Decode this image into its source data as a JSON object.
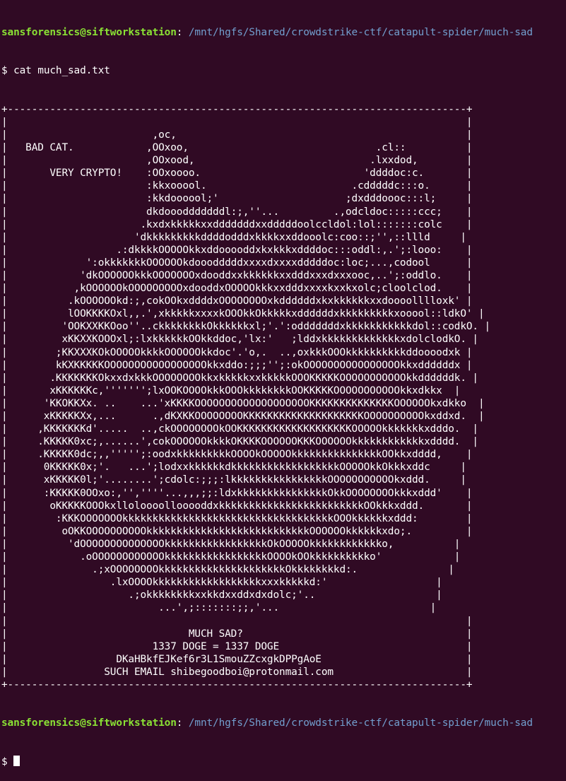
{
  "prompt": {
    "user": "sansforensics@siftworkstation",
    "colon": ":",
    "path": " /mnt/hgfs/Shared/crowdstrike-ctf/catapult-spider/much-sad",
    "dollar": "$ "
  },
  "command": "cat much_sad.txt",
  "file_lines": [
    "+----------------------------------------------------------------------------+",
    "|                                                                            |",
    "|                        ,oc,                                                |",
    "|   BAD CAT.            ,OOxoo,                               .cl::          |",
    "|                       ,OOxood,                             .lxxdod,        |",
    "|       VERY CRYPTO!    :OOxoooo.                           'ddddoc:c.       |",
    "|                       :kkxooool.                        .cdddddc:::o.      |",
    "|                       :kkdoooool;'                     ;dxdddoooc:::l;     |",
    "|                       dkdooodddddddl:;,''...         .,odcldoc:::::ccc;    |",
    "|                      .kxdxkkkkkxxdddddddxxdddddoolccldol:lol:::::::colc    |",
    "|                     'dkkkkkkkkkddddodddxkkkkxxddooolc:coo::;'',::llld     |",
    "|                  .:dkkkkOOOOOkkxddooooddxkxkkkxddddoc:::oddl:,.';:looo:    |",
    "|             ':okkkkkkkOOOOOOkdooodddddxxxxdxxxxdddddoc:loc;...,codool      |",
    "|            'dkOOOOOOkkkOOOOOOOxdooddxxkkkkkkxxdddxxxdxxxooc,..';:oddlo.    |",
    "|           ,kOOOOOOkOOOOOOOOOxdooddxOOOOOkkkxxdddxxxxkxxkxolc;cloolclod.    |",
    "|          .kOOOOOOkd:;,cokOOkxddddxOOOOOOOOxkddddddxkxkkkkkkxxdoooolllloxk' |",
    "|          lOOKKKKOxl,,.',xkkkkkxxxxkOOOkkOkkkkkxddddddxkkkkkkkkkxooool::ldkO' |",
    "|         'OOKXXKKOoo''..ckkkkkkkkOkkkkkkxl;'.':odddddddxkkkkkkkkkkkdol::codkO. |",
    "|         xKKXXKOOOxl;:lxkkkkkkOOkkddoc,'lx:'   ;lddxkkkkkkkkkkkkkxdolclodkO. |",
    "|        ;KKXXXKOkOOOOOkkkkOOOOOOkkdoc'.'o,.  ..,oxkkkOOOkkkkkkkkkkddoooodxk |",
    "|        kKXKKKKKOOOOOOOOOOOOOOOOOkkxddo:;;;'';:okOOOOOOOOOOOOOOOOkkxddddddx |",
    "|       .KKKKKKKOkxxdxkkkOOOOOOOOkkxkkkkkxxkkkkkOOOKKKKKOOOOOOOOOOOkkddddddk. |",
    "|       xKKKKKKc,''''''';lxOOKOOOOkkkOOOkkkkkkkkOOKKKKKOOOOOOOOOOOkkxdkkx  |",
    "|      'KKOKKXx. ..    ...'xKKKKOOOOOOOOOOOOOOOOOOOKKKKKKKKKKKKKKOOOOOOkxdkko  |",
    "|      xKKKKKXx,...      .,dKXKKOOOOOOOOKKKKKKKKKKKKKKKKKKKKOOOOOOOOOOkxddxd.  |",
    "|     ,KKKKKKKd'.....  ..,ckOOOOOOOOkOOKKKKKKKKKKKKKKKKKKKOOOOOkkkkkkkxdddo.  |",
    "|     .KKKKK0xc;,......',cokOOOOOOkkkkOKKKKOOOOOOKKKOOOOOOkkkkkkkkkkkkxdddd.  |",
    "|     .KKKKK0dc;,,''''';:oodxkkkkkkkkkOOOOkOOOOOkkkkkkkkkkkkkkkOOkkxdddd,    |",
    "|      0KKKKK0x;'.   ...';lodxxkkkkkkdkkkkkkkkkkkkkkkkkkOOOOOkkOkkkxddc     |",
    "|      xKKKKK0l;'........';cdolc:;;;:lkkkkkkkkkkkkkkkkOOOOOOOOOOOkxddd.     |",
    "|      :KKKKK0OOxo:,'',''''...,,,;;:ldxkkkkkkkkkkkkkkkOkkOOOOOOOOkkkxddd'    |",
    "|       oKKKKKOOOkxlloloooollooooddxkkkkkkkkkkkkkkkkkkkkkkkkOOkkkxddd.       |",
    "|        :KKKOOOOOOOkkkkkkkkkkkkkkkkkkkkkkkkkkkkkkkkkkkOOOkkkkkkxddd:        |",
    "|         oOKKOOOOOOOOOOkkkkkkkkkkkkkkkkkkkkkkkkkkkOOOOOOkkkkkkxdo;.         |",
    "|          'dOOOOOOOOOOOOOOkkkkkkkkkkkkkkkkkOkOOOOOkkkkkkkkkkkko,          |",
    "|            .oOOOOOOOOOOOOkkkkkkkkkkkkkkkkkOOOOkOOkkkkkkkkkko'            |",
    "|              .;xOOOOOOOOkkkkkkkkkkkkkkkkkkkkkOkkkkkkkkd:.               |",
    "|                 .lxOOOOkkkkkkkkkkkkkkkkkkxxxkkkkkd:'                  |",
    "|                    .;okkkkkkkkxxkkdxxddxdxdolc;'..                    |",
    "|                         ...',;:::::::;;,'...                         |",
    "|                                                                            |",
    "|                              MUCH SAD?                                     |",
    "|                        1337 DOGE = 1337 DOGE                               |",
    "|                  DKaHBkfEJKef6r3L1SmouZZcxgkDPPgAoE                        |",
    "|                SUCH EMAIL shibegoodboi@protonmail.com                      |",
    "+----------------------------------------------------------------------------+"
  ],
  "final_prompt": {
    "user": "sansforensics@siftworkstation",
    "colon": ":",
    "path": " /mnt/hgfs/Shared/crowdstrike-ctf/catapult-spider/much-sad",
    "dollar": "$ "
  },
  "colors": {
    "background": "#300a24",
    "user": "#8ae234",
    "path": "#729fcf",
    "text": "#ffffff"
  }
}
